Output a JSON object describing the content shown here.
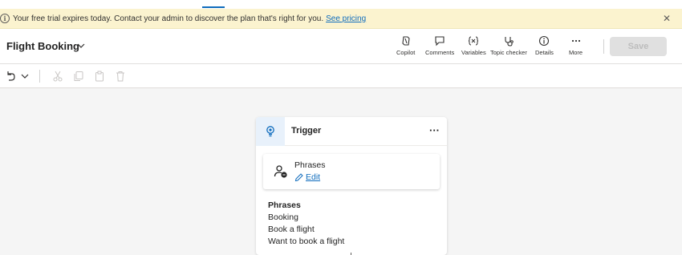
{
  "banner": {
    "message": "Your free trial expires today. Contact your admin to discover the plan that's right for you.",
    "link": "See pricing",
    "info_icon": "info-icon",
    "close_icon": "close-icon"
  },
  "header": {
    "title": "Flight Booking",
    "commands": [
      {
        "label": "Copilot",
        "icon": "copilot-icon"
      },
      {
        "label": "Comments",
        "icon": "comment-icon"
      },
      {
        "label": "Variables",
        "icon": "variables-icon"
      },
      {
        "label": "Topic checker",
        "icon": "stethoscope-icon"
      },
      {
        "label": "Details",
        "icon": "info-icon"
      },
      {
        "label": "More",
        "icon": "more-icon"
      }
    ],
    "save_label": "Save"
  },
  "toolbar": {
    "icons": [
      "undo-icon",
      "chevron-down-icon",
      "cut-icon",
      "copy-icon",
      "paste-icon",
      "delete-icon"
    ]
  },
  "trigger_card": {
    "title": "Trigger",
    "more": "···",
    "phrases_box": {
      "title": "Phrases",
      "edit_label": "Edit"
    },
    "phrases_header": "Phrases",
    "phrases": [
      "Booking",
      "Book a flight",
      "Want to book a flight"
    ]
  },
  "colors": {
    "banner_bg": "#fbf3cf",
    "accent": "#0f6cbd",
    "save_disabled_bg": "#e0e0e0"
  }
}
